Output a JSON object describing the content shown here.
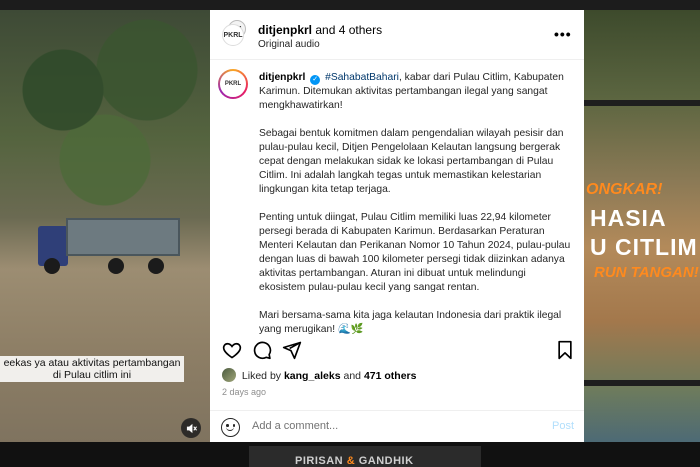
{
  "post": {
    "header": {
      "owner": "ditjenpkrl",
      "and_others": "and 4 others",
      "audio": "Original audio",
      "more_label": "•••"
    },
    "caption": {
      "username": "ditjenpkrl",
      "hashtag": "#SahabatBahari",
      "line1_rest": ", kabar dari Pulau Citlim, Kabupaten Karimun. Ditemukan aktivitas pertambangan ilegal yang sangat mengkhawatirkan!",
      "paragraph2": "Sebagai bentuk komitmen dalam pengendalian wilayah pesisir dan pulau-pulau kecil, Ditjen Pengelolaan Kelautan langsung bergerak cepat dengan melakukan sidak ke lokasi pertambangan di Pulau Citlim. Ini adalah langkah tegas untuk memastikan kelestarian lingkungan kita tetap terjaga.",
      "paragraph3": "Penting untuk diingat, Pulau Citlim memiliki luas 22,94 kilometer persegi berada di Kabupaten Karimun. Berdasarkan Peraturan Menteri Kelautan dan Perikanan Nomor 10 Tahun 2024, pulau-pulau dengan luas di bawah 100 kilometer persegi tidak diizinkan adanya aktivitas pertambangan. Aturan ini dibuat untuk melindungi ekosistem pulau-pulau kecil yang sangat rentan.",
      "paragraph4": "Mari bersama-sama kita jaga kelautan Indonesia dari praktik ilegal yang merugikan! 🌊🌿"
    },
    "likes": {
      "prefix": "Liked by",
      "user": "kang_aleks",
      "connector": "and",
      "count": "471 others"
    },
    "time": "2 days ago",
    "comment": {
      "placeholder": "Add a comment...",
      "post_label": "Post"
    },
    "icons": [
      "heart-icon",
      "comment-icon",
      "share-icon",
      "bookmark-icon",
      "emoji-icon",
      "more-icon",
      "mute-icon"
    ]
  },
  "background": {
    "left_caption": "eekas ya atau aktivitas pertambangan di Pulau citlim ini",
    "right_promo_line1": "ONGKAR!",
    "right_promo_line2": "HASIA",
    "right_promo_line3": "U CITLIM",
    "right_promo_line4": "RUN TANGAN!",
    "bottom_word1": "PIRISAN",
    "bottom_amp": "&",
    "bottom_word2": "GANDHIK"
  },
  "colors": {
    "link": "#00376b",
    "verified": "#0095f6",
    "post_disabled": "#b2dffc",
    "accent_orange": "#ff8a1e"
  }
}
